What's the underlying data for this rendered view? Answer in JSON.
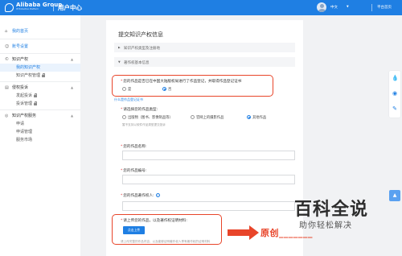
{
  "header": {
    "logo_name": "Alibaba Group",
    "logo_sub": "IP Protection Platform",
    "title": "用户中心",
    "lang": "中文",
    "link": "平台首页"
  },
  "sidebar": {
    "home": "我的首页",
    "account": "账号设置",
    "ip_group": "知识产权",
    "ip_items": [
      "我的知识产权",
      "知识产权管理"
    ],
    "report_group": "侵权投诉",
    "report_items": [
      "发起投诉",
      "投诉管理"
    ],
    "service_group": "知识产权服务",
    "service_items": [
      "申请",
      "申请管理",
      "服务市场"
    ]
  },
  "main": {
    "title": "提交知识产权信息",
    "section_type": "知识产权类型及注册地",
    "section_basic": "著作权基本信息",
    "q_registered": "您的作品是否已在中国大陆版权局进行了作品登记，并取得作品登记证书",
    "opt_yes": "是",
    "opt_no": "否",
    "register_link": "什么是作品登记证书",
    "q_type": "请选择您的作品类型:",
    "type_options": [
      "出版物（图书、影像制品等）",
      "官网上的摄影作品",
      "其他作品"
    ],
    "type_hint": "暂不支持以软件作品类型提交投诉",
    "q_name": "您的作品名称:",
    "q_number": "您的作品编号:",
    "q_owner": "您的作品著作权人:",
    "q_upload": "请上传您的作品，以及著作权证明材料:",
    "upload_button": "点击上传",
    "upload_hint": "请上传完整的作品内容，以及能够证明著作权人享有著作权的证明材料"
  },
  "annotation": {
    "caption": "原创_______"
  },
  "watermark": {
    "main": "百科全说",
    "sub": "助你轻松解决"
  },
  "colors": {
    "brand_blue": "#1f7fe3",
    "annotation_red": "#e8452a"
  }
}
